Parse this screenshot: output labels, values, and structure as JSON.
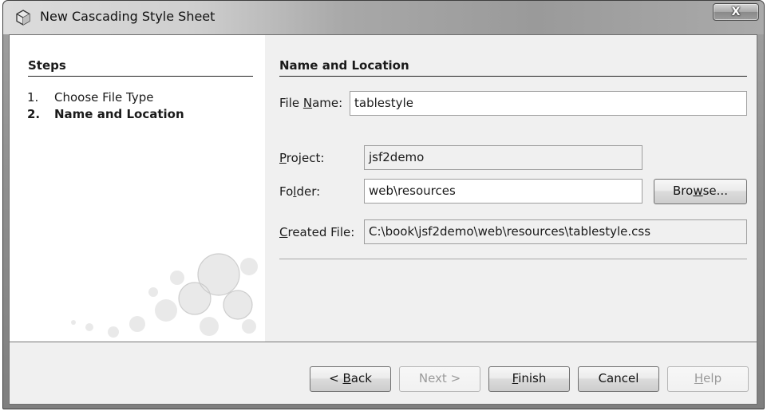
{
  "window": {
    "title": "New Cascading Style Sheet",
    "close_label": "X"
  },
  "steps": {
    "heading": "Steps",
    "items": [
      {
        "number": "1.",
        "label": "Choose File Type"
      },
      {
        "number": "2.",
        "label": "Name and Location"
      }
    ]
  },
  "content": {
    "heading": "Name and Location",
    "file_name": {
      "label_pre": "File ",
      "label_mnemonic": "N",
      "label_post": "ame:",
      "value": "tablestyle"
    },
    "project": {
      "label_mnemonic": "P",
      "label_post": "roject:",
      "value": "jsf2demo"
    },
    "folder": {
      "label_pre": "Fo",
      "label_mnemonic": "l",
      "label_post": "der:",
      "value": "web\\resources"
    },
    "created_file": {
      "label_mnemonic": "C",
      "label_post": "reated File:",
      "value": "C:\\book\\jsf2demo\\web\\resources\\tablestyle.css"
    },
    "browse": {
      "pre": "Bro",
      "mnemonic": "w",
      "post": "se..."
    }
  },
  "footer": {
    "back": {
      "pre": "< ",
      "mnemonic": "B",
      "post": "ack"
    },
    "next": {
      "label": "Next >"
    },
    "finish": {
      "mnemonic": "F",
      "post": "inish"
    },
    "cancel": {
      "label": "Cancel"
    },
    "help": {
      "mnemonic": "H",
      "post": "elp"
    }
  },
  "colors": {
    "panel_background": "#f0f0f0",
    "steps_background": "#ffffff",
    "title_bar": "#a8a8a8"
  }
}
